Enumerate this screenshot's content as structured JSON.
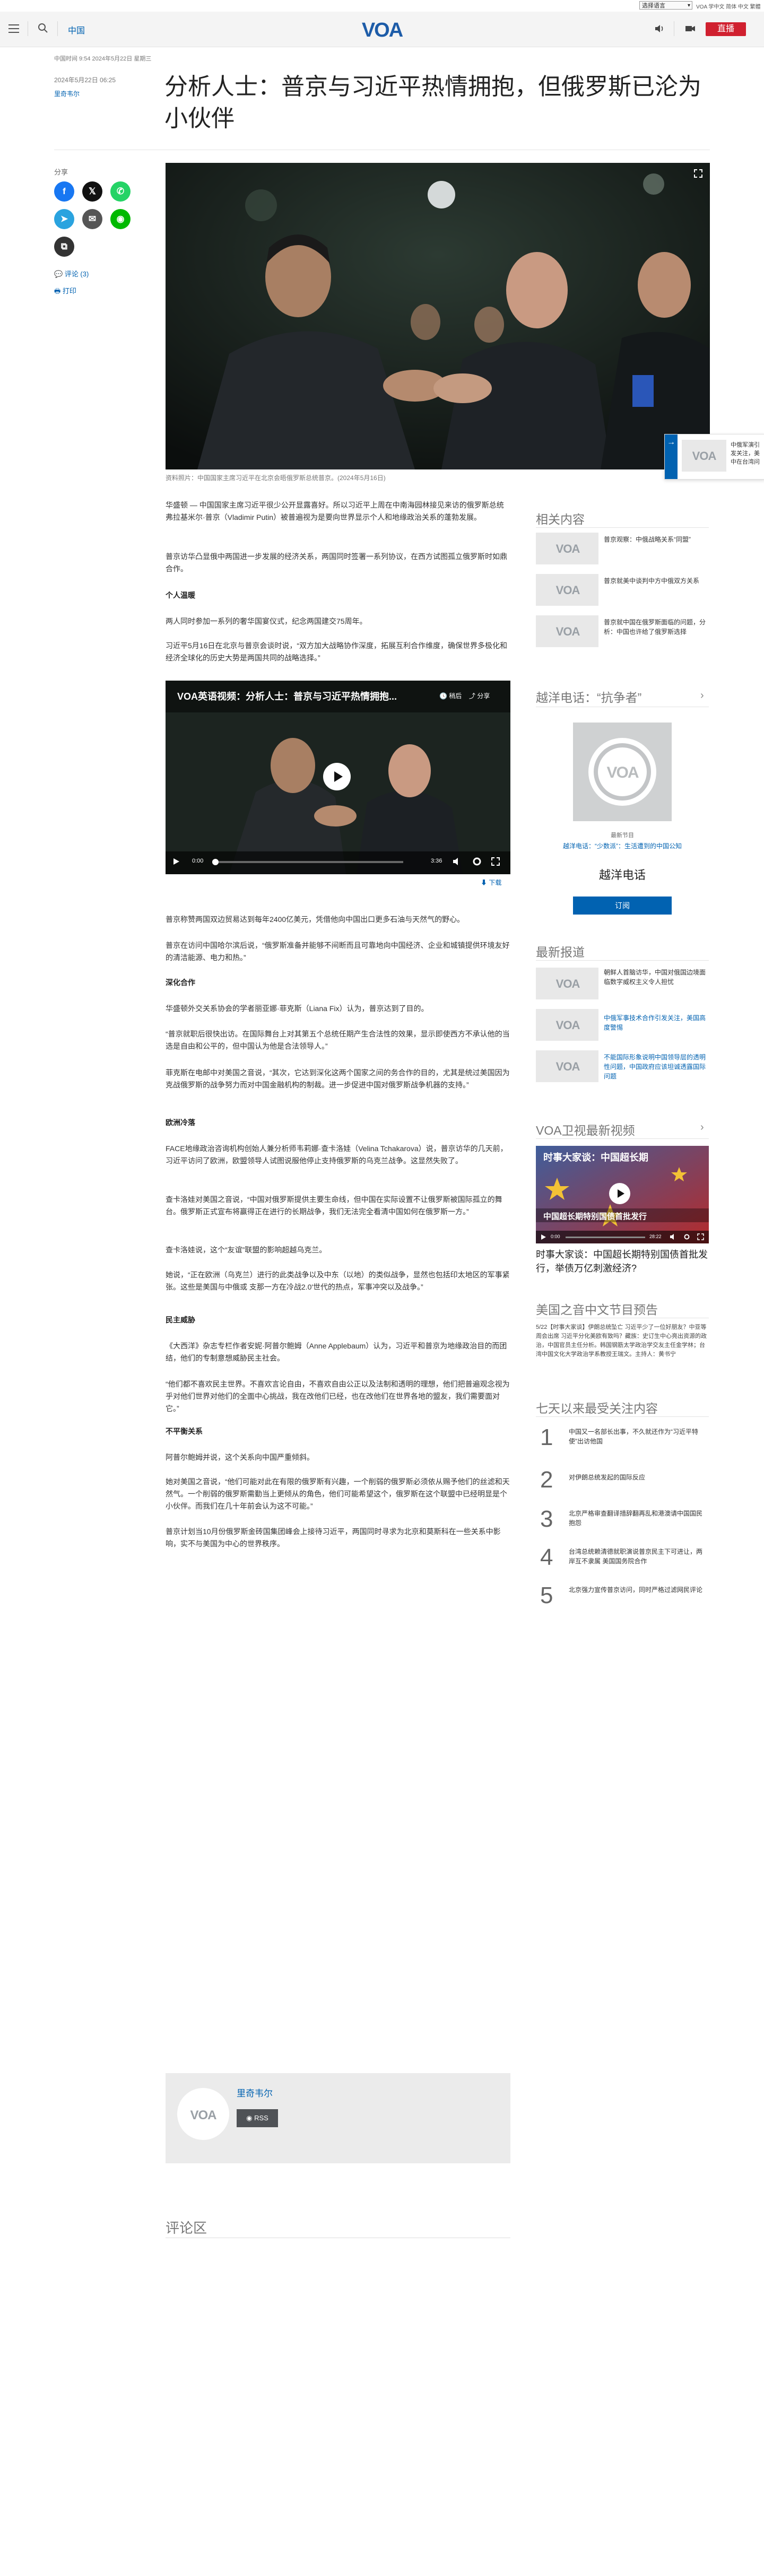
{
  "util": {
    "lang": "选择语言",
    "links": "VOA 学中文  简体 中文  繁體"
  },
  "header": {
    "section": "中国",
    "logo": "VOA",
    "live": "直播"
  },
  "article": {
    "dateline": "中国时间 9:54 2024年5月22日 星期三",
    "published": "2024年5月22日 06:25",
    "author": "里奇韦尔",
    "title": "分析人士：普京与习近平热情拥抱，但俄罗斯已沦为小伙伴",
    "caption": "资料照片：中国国家主席习近平在北京会晤俄罗斯总统普京。(2024年5月16日)",
    "paragraphs": [
      "华盛顿 — 中国国家主席习近平很少公开显露喜好。所以习近平上周在中南海园林接见来访的俄罗斯总统弗拉基米尔·普京（Vladimir Putin）被普遍视为是要向世界显示个人和地缘政治关系的蓬勃发展。",
      "普京访华凸显俄中两国进一步发展的经济关系，两国同时签署一系列协议，在西方试图孤立俄罗斯时如鼎合作。"
    ],
    "h1": "个人温暖",
    "p3": "两人同时参加一系列的奢华国宴仪式，纪念两国建交75周年。",
    "p4": "习近平5月16日在北京与普京会谈时说，“双方加大战略协作深度，拓展互利合作维度，确保世界多极化和经济全球化的历史大势是两国共同的战略选择。”",
    "p5": "普京称赞两国双边贸易达到每年2400亿美元，凭借他向中国出口更多石油与天然气的野心。",
    "p6": "普京在访问中国哈尔滨后说，“俄罗斯准备并能够不间断而且可靠地向中国经济、企业和城镇提供环境友好的清洁能源、电力和热。”",
    "h2": "深化合作",
    "p7": "华盛顿外交关系协会的学者丽亚娜·菲克斯（Liana Fix）认为，普京达到了目的。",
    "p8": "“普京就职后很快出访。在国际舞台上对其第五个总统任期产生合法性的效果，显示即使西方不承认他的当选是自由和公平的，但中国认为他是合法领导人。”",
    "p9": "菲克斯在电邮中对美国之音说，“其次，它达到深化这两个国家之间的务合作的目的，尤其是统过美国因为克战俄罗斯的战争努力而对中国金融机构的制裁。进一步促进中国对俄罗斯战争机器的支持。”",
    "h3": "欧洲冷落",
    "p10": "FACE地缘政治咨询机构创始人兼分析师韦莉娜·查卡洛娃（Velina Tchakarova）说，普京访华的几天前，习近平访问了欧洲，欧盟领导人试图说服他停止支持俄罗斯的乌克兰战争。这显然失败了。",
    "p11": "查卡洛娃对美国之音说，“中国对俄罗斯提供主要生命线，但中国在实际设置不让俄罗斯被国际孤立的舞台。俄罗斯正式宣布将赢得正在进行的长期战争，我们无法完全看清中国如何在俄罗斯一方。”",
    "p12": "查卡洛娃说，这个“友谊”联盟的影响超越乌克兰。",
    "p13": "她说，“正在欧洲（乌克兰）进行的此类战争以及中东（以地）的类似战争，显然也包括印太地区的军事紧张。这些是美国与中俄或 支那一方在冷战2.0'世代的热点，军事冲突以及战争。”",
    "h4": "民主威胁",
    "p14": "《大西洋》杂志专栏作者安妮·阿普尔鲍姆（Anne Applebaum）认为，习近平和普京为地缘政治目的而团结，他们的专制意想威胁民主社会。",
    "p15": "“他们都不喜欢民主世界。不喜欢言论自由，不喜欢自由公正以及法制和透明的理想，他们把普遍观念视为乎对他们世界对他们的全面中心挑战，我在改他们已经，也在改他们在世界各地的盟友，我们需要面对它。”",
    "h5": "不平衡关系",
    "p16": "阿普尔鲍姆并说，这个关系向中国严重倾斜。",
    "p17": "她对美国之音说，“他们可能对此在有限的俄罗斯有兴趣，一个削弱的俄罗斯必须依从赐予他们的丝滤和天然气。一个削弱的俄罗斯需勤当上更倾从的角色，他们可能希望这个，俄罗斯在这个联盟中已经明显是个小伙伴。而我们在几十年前会认为这不可能。”",
    "p18": "普京计划当10月份俄罗斯金砖国集团峰会上接待习近平，两国同时寻求为北京和莫斯科在一些关系中影响，实不与美国为中心的世界秩序。"
  },
  "share": {
    "label": "分享",
    "comments": "评论 (3)",
    "print": "打印"
  },
  "video": {
    "title": "VOA英语视频：分析人士：普京与习近平热情拥抱...",
    "watch_later": "稍后",
    "share": "分享",
    "current_time": "0:00",
    "duration": "3:36",
    "download": "下载"
  },
  "author_box": {
    "name": "里奇韦尔",
    "rss": "RSS"
  },
  "comments_heading": "评论区",
  "floating": {
    "text": "中俄军演引发关注，美中在台湾问题上分歧..."
  },
  "sidebar": {
    "related": {
      "title": "相关内容",
      "items": [
        "普京观察：中俄战略关系“同盟”",
        "普京就美中谈判中方中俄双方关系",
        "普京就中国在俄罗斯面临的问题，分析：中国也许给了俄罗斯选择"
      ]
    },
    "podcast": {
      "title": "越洋电话：“抗争者”",
      "latest_label": "最新节目",
      "latest_title": "越洋电话：“少数派”：生活遭到的中国公知",
      "name": "越洋电话",
      "subscribe": "订阅"
    },
    "latest": {
      "title": "最新报道",
      "items": [
        "朝鲜人首脑访华，中国对俄国边境面临数字威权主义令人担忧",
        "中俄军事技术合作引发关注，美国高度警惕",
        "不能国际形象说明中国领导层的透明性问题，中国政府应该坦诚透露国际问题"
      ]
    },
    "tv": {
      "title": "VOA卫视最新视频",
      "overlay_title": "时事大家谈：中国超长期",
      "banner": "中国超长期特别国债首批发行",
      "current_time": "0:00",
      "duration": "28:22",
      "caption": "时事大家谈：中国超长期特别国债首批发行，举债万亿刺激经济?"
    },
    "schedule": {
      "title": "美国之音中文节目预告",
      "text": "5/22【时事大家谈】伊朗总统坠亡 习近平少了一位好朋友？中亚等周会出席 习近平分化美欧有致吗？藏族：史订生中心亮出资源的政治，中国官员主任分析。韩国钢筋太学政治学交友主任金学林；台湾中国文化大学政治学系教授王瑞文。主持人：黄书宁"
    },
    "popular": {
      "title": "七天以来最受关注内容",
      "items": [
        {
          "rank": "1",
          "text": "中国又一名部长出事，不久就还作为“习近平特使”出访他国"
        },
        {
          "rank": "2",
          "text": "对伊朗总统发起的国际反应"
        },
        {
          "rank": "3",
          "text": "北京严格审查翻译措辞翻再乱和港澳请中国国民抱怨"
        },
        {
          "rank": "4",
          "text": "台湾总统赖清德就职演说普京民主下可进让，两岸互不隶属 美国国务院合作"
        },
        {
          "rank": "5",
          "text": "北京强力宣传普京访问，同时严格过滤网民评论"
        }
      ]
    }
  }
}
